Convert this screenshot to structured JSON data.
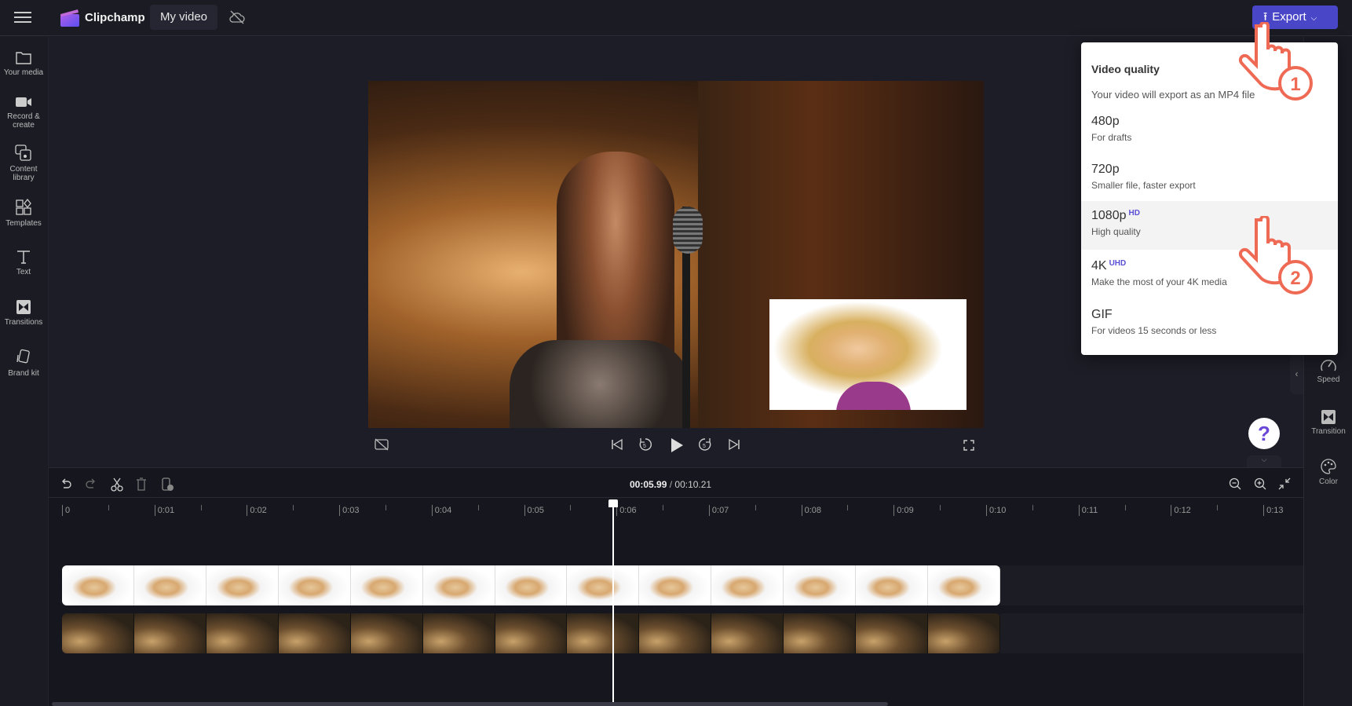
{
  "app": {
    "name": "Clipchamp",
    "project_title": "My video",
    "cloud_status_icon": "cloud-off-icon"
  },
  "sidebar": {
    "items": [
      {
        "label": "Your media",
        "icon": "folder-icon"
      },
      {
        "label": "Record &",
        "label2": "create",
        "icon": "camera-icon"
      },
      {
        "label": "Content",
        "label2": "library",
        "icon": "library-icon"
      },
      {
        "label": "Templates",
        "icon": "templates-icon"
      },
      {
        "label": "Text",
        "icon": "text-icon"
      },
      {
        "label": "Transitions",
        "icon": "transitions-icon"
      },
      {
        "label": "Brand kit",
        "icon": "brand-kit-icon"
      }
    ]
  },
  "export": {
    "label": "Export",
    "accent": "#4a46c8"
  },
  "dropdown": {
    "title": "Video quality",
    "subtitle": "Your video will export as an MP4 file",
    "options": [
      {
        "label": "480p",
        "badge": "",
        "desc": "For drafts"
      },
      {
        "label": "720p",
        "badge": "",
        "desc": "Smaller file, faster export"
      },
      {
        "label": "1080p",
        "badge": "HD",
        "desc": "High quality",
        "highlighted": true
      },
      {
        "label": "4K",
        "badge": "UHD",
        "desc": "Make the most of your 4K media"
      },
      {
        "label": "GIF",
        "badge": "",
        "desc": "For videos 15 seconds or less"
      }
    ]
  },
  "callouts": [
    "1",
    "2"
  ],
  "right_panel": {
    "items": [
      {
        "label": "Speed",
        "icon": "speed-icon"
      },
      {
        "label": "Transition",
        "icon": "transition-icon"
      },
      {
        "label": "Color",
        "icon": "palette-icon"
      }
    ]
  },
  "help": {
    "label": "?"
  },
  "timeline": {
    "current_time": "00:05.99",
    "separator": " / ",
    "total_time": "00:10.21",
    "ruler": [
      "0",
      "0:01",
      "0:02",
      "0:03",
      "0:04",
      "0:05",
      "0:06",
      "0:07",
      "0:08",
      "0:09",
      "0:10",
      "0:11",
      "0:12",
      "0:13"
    ]
  }
}
